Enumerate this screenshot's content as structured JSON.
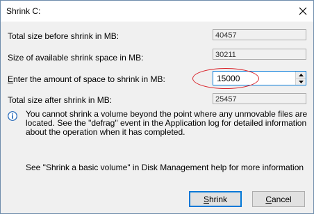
{
  "window": {
    "title": "Shrink C:",
    "close_icon": "close-icon"
  },
  "fields": {
    "total_size_label": "Total size before shrink in MB:",
    "total_size_value": "40457",
    "available_label": "Size of available shrink space in MB:",
    "available_value": "30211",
    "amount_label_accel": "E",
    "amount_label_rest": "nter the amount of space to shrink in MB:",
    "amount_value": "15000",
    "after_label": "Total size after shrink in MB:",
    "after_value": "25457"
  },
  "info": {
    "icon": "info-icon",
    "message": "You cannot shrink a volume beyond the point where any unmovable files are located. See the \"defrag\" event in the Application log for detailed information about the operation when it has completed."
  },
  "help": {
    "text": "See \"Shrink a basic volume\" in Disk Management help for more information"
  },
  "buttons": {
    "shrink_accel": "S",
    "shrink_rest": "hrink",
    "cancel_accel": "C",
    "cancel_rest": "ancel"
  },
  "colors": {
    "focus_border": "#0078d7",
    "highlight_circle": "#d9232a",
    "info_icon": "#1c63b7"
  }
}
